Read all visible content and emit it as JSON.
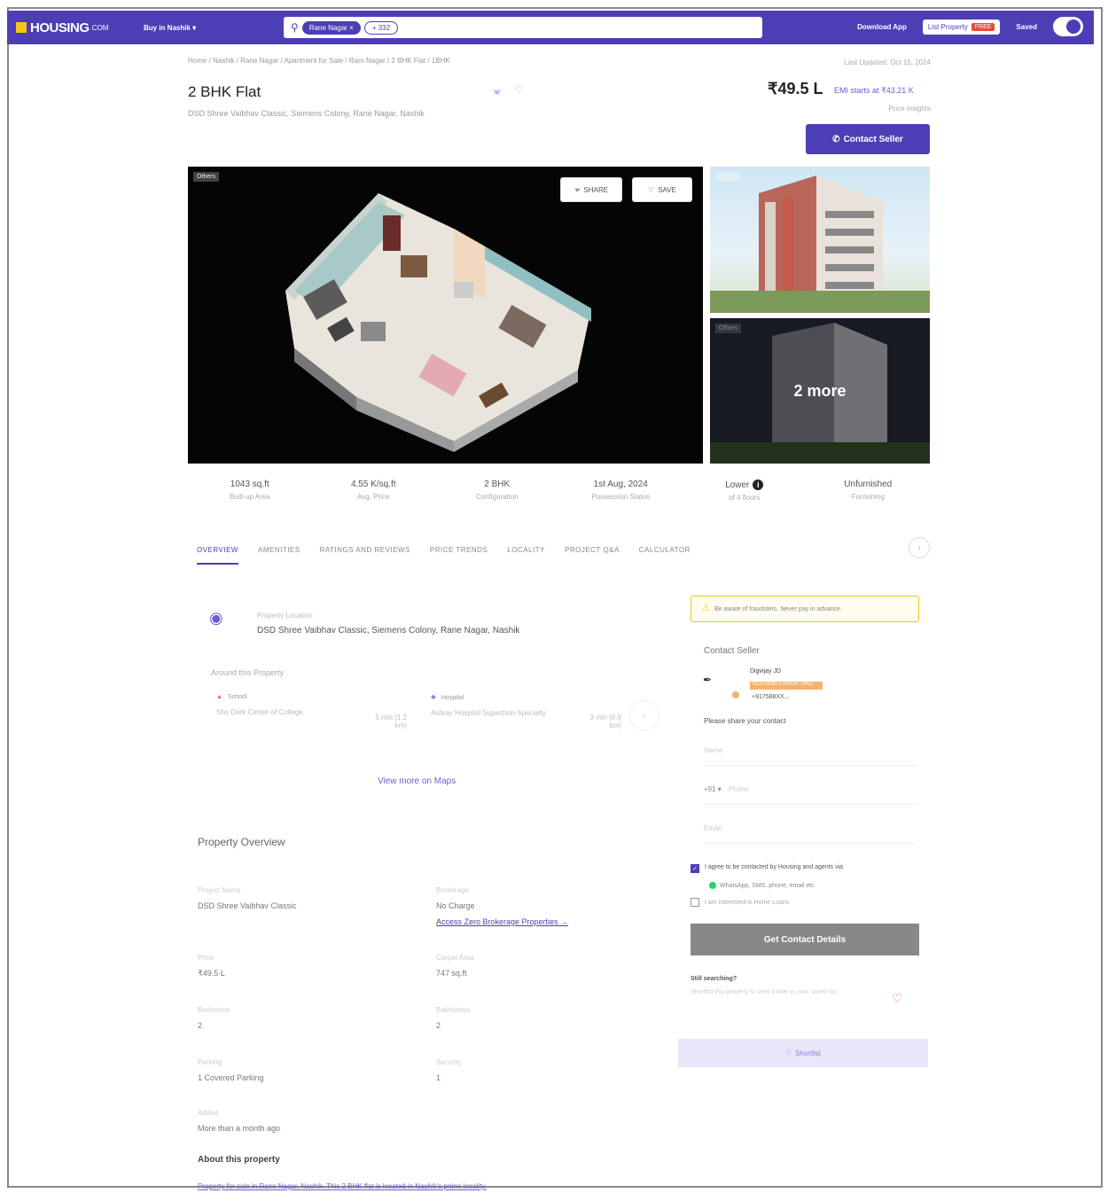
{
  "header": {
    "logo": "HOUSING",
    "logo_suffix": ".COM",
    "buy_menu": "Buy in Nashik ▾",
    "search_chip": "Rane Nagar ×",
    "search_more": "+ 332",
    "download_app": "Download App",
    "list_property": "List Property",
    "free_badge": "FREE",
    "saved": "Saved"
  },
  "listing": {
    "breadcrumb": "Home / Nashik / Rane Nagar / Apartment for Sale / Ram Nagar / 2 BHK Flat / 1BHK",
    "listed_on": "Last Updated: Oct 15, 2024",
    "title": "2 BHK Flat",
    "subaddress": "DSD Shree Vaibhav Classic, Siemens Colony, Rane Nagar, Nashik",
    "price": "₹49.5 L",
    "emi": "EMI starts at ₹43.21 K",
    "news": "Price insights",
    "contact_seller": "Contact Seller"
  },
  "gallery": {
    "main_tag": "Others",
    "side1_tag": "Others",
    "side2_tag": "Others",
    "share": "SHARE",
    "save": "SAVE",
    "more": "2 more"
  },
  "stats": [
    {
      "value": "1043 sq.ft",
      "label": "Built-up Area"
    },
    {
      "value": "4.55 K/sq.ft",
      "label": "Avg. Price"
    },
    {
      "value": "2 BHK",
      "label": "Configuration"
    },
    {
      "value": "1st Aug, 2024",
      "label": "Possession Status"
    },
    {
      "value": "Lower",
      "label": "of 4 floors"
    },
    {
      "value": "Unfurnished",
      "label": "Furnishing"
    }
  ],
  "tabs": [
    "OVERVIEW",
    "AMENITIES",
    "RATINGS AND REVIEWS",
    "PRICE TRENDS",
    "LOCALITY",
    "PROJECT Q&A",
    "CALCULATOR"
  ],
  "location": {
    "label": "Property Location",
    "address": "DSD Shree Vaibhav Classic, Siemens Colony, Rane Nagar, Nashik",
    "around": "Around this Property",
    "poi": [
      {
        "type": "School",
        "name": "Sho Dark Center of College",
        "time": "5 min (1.2 km)"
      },
      {
        "type": "Hospital",
        "name": "Ashray Hospital Superthon Specialty",
        "time": "3 min (0.9 km)"
      }
    ],
    "view_maps": "View more on Maps"
  },
  "overview": {
    "title": "Property Overview",
    "items": [
      {
        "key": "Project Name",
        "value": "DSD Shree Vaibhav Classic"
      },
      {
        "key": "Brokerage",
        "value": "No Charge",
        "link": "Access Zero Brokerage Properties →"
      },
      {
        "key": "Price",
        "value": "₹49.5 L"
      },
      {
        "key": "Carpet Area",
        "value": "747 sq.ft"
      },
      {
        "key": "Bedrooms",
        "value": "2"
      },
      {
        "key": "Bathrooms",
        "value": "2"
      },
      {
        "key": "Parking",
        "value": "1 Covered Parking"
      },
      {
        "key": "Security",
        "value": "1"
      },
      {
        "key": "Added",
        "value": "More than a month ago"
      }
    ],
    "about": "About this property",
    "about_text": "Property for sale in Rane Nagar, Nashik. This 2 BHK flat is located in Nashik's prime locality."
  },
  "contact": {
    "notice": "Be aware of fraudsters. Never pay in advance.",
    "title": "Contact Seller",
    "seller_name": "Digvijay JD",
    "seller_badge": "HOUSING EXPERT PRO",
    "seller_phone": "+917588XX...",
    "share_details": "Please share your contact",
    "name_placeholder": "Name",
    "phone_code": "+91 ▾",
    "phone_placeholder": "Phone",
    "email_placeholder": "Email",
    "consent": "I agree to be contacted by Housing and agents via",
    "whatsapp": "WhatsApp, SMS, phone, email etc",
    "home_loan": "I am interested in Home Loans",
    "get_details": "Get Contact Details",
    "still_title": "Still searching?",
    "still_sub": "Shortlist this property to view it later in your saved list",
    "shortlist": "Shortlist"
  }
}
